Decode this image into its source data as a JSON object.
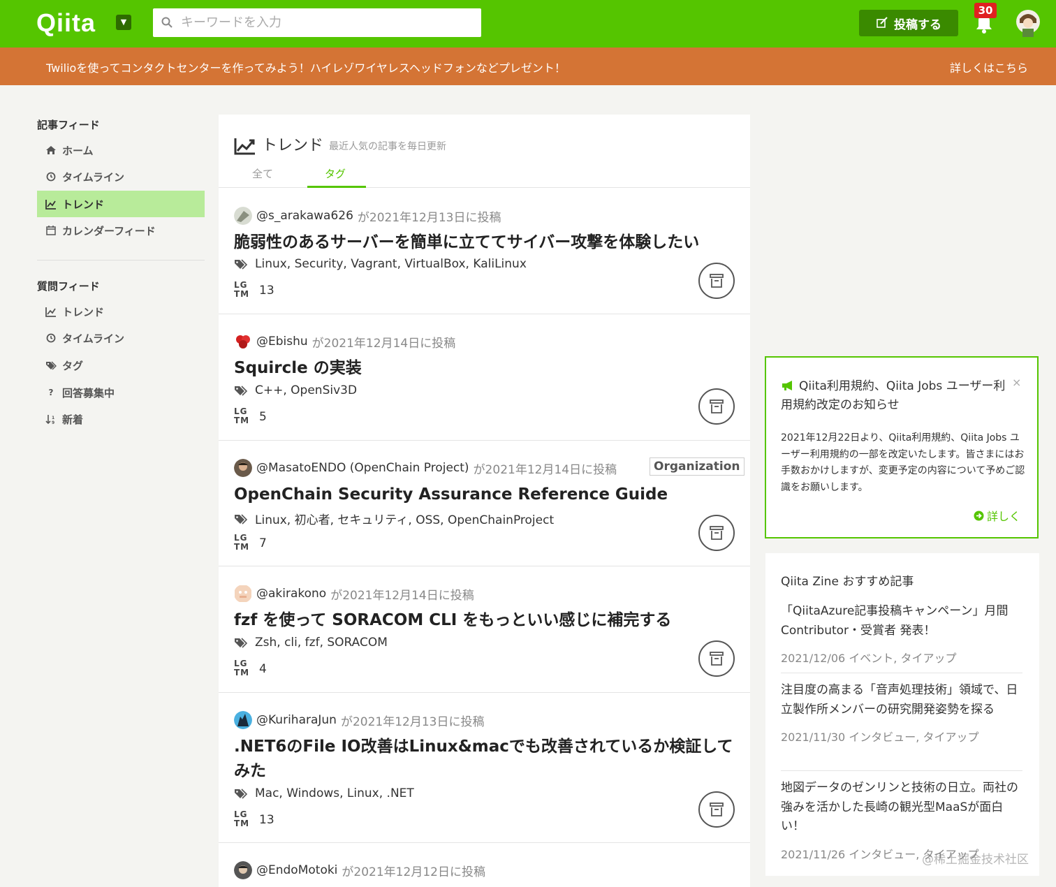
{
  "header": {
    "logo": "Qiita",
    "search_placeholder": "キーワードを入力",
    "post_button": "投稿する",
    "notification_count": "30"
  },
  "banner": {
    "text": "Twilioを使ってコンタクトセンターを作ってみよう！ハイレゾワイヤレスヘッドフォンなどプレゼント！",
    "link": "詳しくはこちら"
  },
  "sidebar": {
    "article_feed": {
      "heading": "記事フィード",
      "items": [
        {
          "label": "ホーム",
          "icon": "home-icon"
        },
        {
          "label": "タイムライン",
          "icon": "clock-icon"
        },
        {
          "label": "トレンド",
          "icon": "trend-icon",
          "active": true
        },
        {
          "label": "カレンダーフィード",
          "icon": "calendar-icon"
        }
      ]
    },
    "question_feed": {
      "heading": "質問フィード",
      "items": [
        {
          "label": "トレンド",
          "icon": "trend-icon"
        },
        {
          "label": "タイムライン",
          "icon": "clock-icon"
        },
        {
          "label": "タグ",
          "icon": "tags-icon"
        },
        {
          "label": "回答募集中",
          "icon": "question-icon"
        },
        {
          "label": "新着",
          "icon": "sort-icon"
        }
      ]
    }
  },
  "main": {
    "title": "トレンド",
    "subtitle": "最近人気の記事を毎日更新",
    "tabs": [
      {
        "label": "全て",
        "active": false
      },
      {
        "label": "タグ",
        "active": true
      }
    ],
    "lgtm_label": "LG TM",
    "articles": [
      {
        "user": "@s_arakawa626",
        "posted": "が2021年12月13日に投稿",
        "title": "脆弱性のあるサーバーを簡単に立ててサイバー攻撃を体験したい",
        "tags": "Linux,  Security,  Vagrant,  VirtualBox,  KaliLinux",
        "lgtm": "13",
        "avatar_color": "#a8b0a0"
      },
      {
        "user": "@Ebishu",
        "posted": "が2021年12月14日に投稿",
        "title": "Squircle の実装",
        "tags": "C++,  OpenSiv3D",
        "lgtm": "5",
        "avatar_color": "#d42020"
      },
      {
        "user": "@MasatoENDO (OpenChain Project)",
        "posted": "が2021年12月14日に投稿",
        "title": "OpenChain Security Assurance Reference Guide",
        "tags": "Linux,  初心者,  セキュリティ,  OSS,  OpenChainProject",
        "lgtm": "7",
        "organization": "Organization",
        "avatar_color": "#5a4a3a"
      },
      {
        "user": "@akirakono",
        "posted": "が2021年12月14日に投稿",
        "title": "fzf を使って SORACOM CLI をもっといい感じに補完する",
        "tags": "Zsh,  cli,  fzf,  SORACOM",
        "lgtm": "4",
        "avatar_color": "#f0c8a8"
      },
      {
        "user": "@KuriharaJun",
        "posted": "が2021年12月13日に投稿",
        "title": ".NET6のFile IO改善はLinux&macでも改善されているか検証してみた",
        "tags": "Mac,  Windows,  Linux,  .NET",
        "lgtm": "13",
        "avatar_color": "#3aa0d8"
      },
      {
        "user": "@EndoMotoki",
        "posted": "が2021年12月12日に投稿",
        "avatar_color": "#444444"
      }
    ]
  },
  "notice": {
    "title": "Qiita利用規約、Qiita Jobs ユーザー利用規約改定のお知らせ",
    "close": "×",
    "body": "2021年12月22日より、Qiita利用規約、Qiita Jobs ユーザー利用規約の一部を改定いたします。皆さまにはお手数おかけしますが、変更予定の内容について予めご認識をお願いします。",
    "more": "詳しく"
  },
  "zine": {
    "title": "Qiita Zine おすすめ記事",
    "items": [
      {
        "title": "「QiitaAzure記事投稿キャンペーン」月間Contributor・受賞者 発表！",
        "meta": "2021/12/06  イベント, タイアップ"
      },
      {
        "title": "注目度の高まる「音声処理技術」領域で、日立製作所メンバーの研究開発姿勢を探る",
        "meta": "2021/11/30  インタビュー, タイアップ"
      },
      {
        "title": "地図データのゼンリンと技術の日立。両社の強みを活かした長崎の観光型MaaSが面白い！",
        "meta": "2021/11/26  インタビュー, タイアップ"
      }
    ]
  },
  "watermark": "@稀土掘金技术社区",
  "colors": {
    "brand_green": "#55c500",
    "banner_orange": "#d47435",
    "post_button": "#3a8a00",
    "active_nav": "#b8eb9a"
  }
}
